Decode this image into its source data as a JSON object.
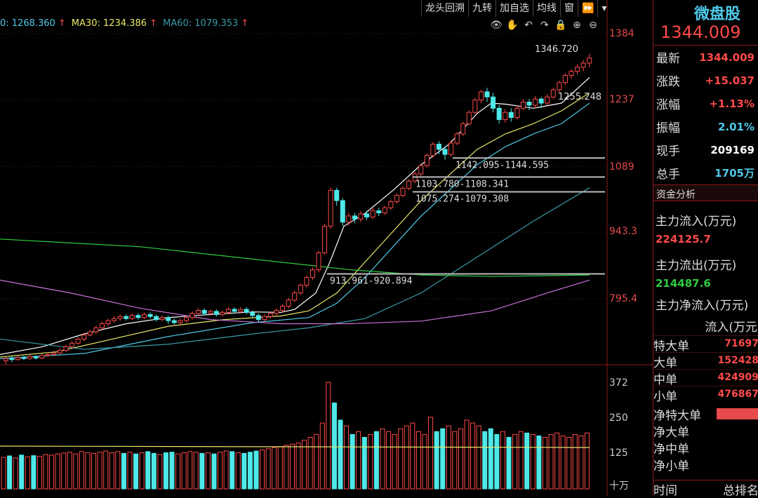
{
  "toolbar": {
    "items": [
      "龙头回溯",
      "九转",
      "加自选",
      "均线",
      "窗"
    ]
  },
  "ma_legend": {
    "ma10": {
      "label": "0: 1268.360",
      "color": "#4ec9e8"
    },
    "ma30": {
      "label": "MA30: 1234.386",
      "color": "#e8e86a"
    },
    "ma60": {
      "label": "MA60: 1079.353",
      "color": "#3a9aa8"
    },
    "up_arrow": "↑"
  },
  "price_axis": [
    "1384",
    "1237",
    "1089",
    "943.3",
    "795.4"
  ],
  "volume_axis": [
    "372",
    "250",
    "125",
    "十万"
  ],
  "annotations": {
    "high": "1346.720",
    "ma_level": "1255.248",
    "gap1": "1142.095-1144.595",
    "gap2": "1103.780-1108.341",
    "gap3": "1075.274-1079.308",
    "gap4": "913.961-920.894"
  },
  "right_panel": {
    "title": "微盘股",
    "price": "1344.009",
    "rows": [
      {
        "key": "最新",
        "value": "1344.009",
        "color": "red"
      },
      {
        "key": "涨跌",
        "value": "+15.037",
        "color": "red"
      },
      {
        "key": "涨幅",
        "value": "+1.13%",
        "color": "red"
      },
      {
        "key": "振幅",
        "value": "2.01%",
        "color": "cyan"
      },
      {
        "key": "现手",
        "value": "209169",
        "color": "white"
      },
      {
        "key": "总手",
        "value": "1705万",
        "color": "cyan"
      }
    ],
    "section": "资金分析",
    "inflow_label": "主力流入(万元)",
    "inflow_value": "224125.7",
    "outflow_label": "主力流出(万元)",
    "outflow_value": "214487.6",
    "net_label": "主力净流入(万元)",
    "table_head": "流入(万元",
    "table_rows": [
      {
        "key": "特大单",
        "value": "71697"
      },
      {
        "key": "大单",
        "value": "152428"
      },
      {
        "key": "中单",
        "value": "424909"
      },
      {
        "key": "小单",
        "value": "476867"
      }
    ],
    "net_rows": [
      "净特大单",
      "净大单",
      "净中单",
      "净小单"
    ],
    "footer_left": "时间",
    "footer_right": "总排名"
  },
  "chart_data": {
    "type": "candlestick",
    "ylim": [
      740,
      1410
    ],
    "candles": [
      [
        748,
        752,
        741,
        755
      ],
      [
        752,
        750,
        745,
        756
      ],
      [
        750,
        754,
        748,
        758
      ],
      [
        754,
        752,
        749,
        757
      ],
      [
        752,
        756,
        750,
        760
      ],
      [
        756,
        753,
        750,
        758
      ],
      [
        753,
        758,
        751,
        762
      ],
      [
        758,
        760,
        755,
        764
      ],
      [
        760,
        763,
        757,
        767
      ],
      [
        763,
        768,
        760,
        772
      ],
      [
        768,
        775,
        765,
        779
      ],
      [
        775,
        782,
        772,
        786
      ],
      [
        782,
        790,
        779,
        794
      ],
      [
        790,
        798,
        786,
        802
      ],
      [
        798,
        804,
        795,
        808
      ],
      [
        804,
        812,
        800,
        816
      ],
      [
        812,
        820,
        808,
        824
      ],
      [
        820,
        826,
        816,
        830
      ],
      [
        826,
        830,
        822,
        835
      ],
      [
        830,
        834,
        826,
        838
      ],
      [
        834,
        830,
        826,
        838
      ],
      [
        830,
        836,
        827,
        840
      ],
      [
        836,
        832,
        828,
        840
      ],
      [
        832,
        838,
        829,
        842
      ],
      [
        838,
        834,
        830,
        842
      ],
      [
        834,
        828,
        824,
        838
      ],
      [
        828,
        832,
        825,
        836
      ],
      [
        832,
        826,
        820,
        836
      ],
      [
        826,
        822,
        818,
        830
      ],
      [
        822,
        826,
        818,
        830
      ],
      [
        826,
        832,
        822,
        836
      ],
      [
        832,
        840,
        828,
        844
      ],
      [
        840,
        846,
        836,
        850
      ],
      [
        846,
        840,
        836,
        850
      ],
      [
        840,
        844,
        836,
        848
      ],
      [
        844,
        838,
        834,
        848
      ],
      [
        838,
        842,
        834,
        846
      ],
      [
        842,
        848,
        838,
        852
      ],
      [
        848,
        844,
        840,
        852
      ],
      [
        844,
        848,
        840,
        852
      ],
      [
        848,
        842,
        838,
        852
      ],
      [
        842,
        836,
        832,
        846
      ],
      [
        836,
        828,
        822,
        840
      ],
      [
        828,
        834,
        824,
        838
      ],
      [
        834,
        840,
        830,
        844
      ],
      [
        840,
        846,
        836,
        850
      ],
      [
        846,
        854,
        842,
        858
      ],
      [
        854,
        866,
        850,
        870
      ],
      [
        866,
        880,
        862,
        884
      ],
      [
        880,
        895,
        876,
        898
      ],
      [
        895,
        910,
        890,
        914
      ],
      [
        910,
        925,
        905,
        930
      ],
      [
        925,
        958,
        920,
        962
      ],
      [
        958,
        1010,
        955,
        1015
      ],
      [
        1010,
        1080,
        1005,
        1085
      ],
      [
        1080,
        1060,
        1050,
        1085
      ],
      [
        1060,
        1018,
        1010,
        1065
      ],
      [
        1018,
        1030,
        1012,
        1036
      ],
      [
        1030,
        1024,
        1016,
        1036
      ],
      [
        1024,
        1034,
        1018,
        1040
      ],
      [
        1034,
        1028,
        1022,
        1040
      ],
      [
        1028,
        1040,
        1024,
        1046
      ],
      [
        1040,
        1036,
        1030,
        1046
      ],
      [
        1036,
        1046,
        1032,
        1050
      ],
      [
        1046,
        1058,
        1042,
        1062
      ],
      [
        1058,
        1070,
        1054,
        1074
      ],
      [
        1070,
        1084,
        1066,
        1088
      ],
      [
        1084,
        1098,
        1080,
        1102
      ],
      [
        1098,
        1112,
        1094,
        1116
      ],
      [
        1112,
        1128,
        1108,
        1132
      ],
      [
        1128,
        1148,
        1124,
        1152
      ],
      [
        1148,
        1170,
        1144,
        1174
      ],
      [
        1170,
        1160,
        1150,
        1176
      ],
      [
        1160,
        1150,
        1140,
        1166
      ],
      [
        1150,
        1172,
        1146,
        1178
      ],
      [
        1172,
        1190,
        1168,
        1194
      ],
      [
        1190,
        1210,
        1186,
        1214
      ],
      [
        1210,
        1232,
        1206,
        1236
      ],
      [
        1232,
        1256,
        1228,
        1260
      ],
      [
        1256,
        1272,
        1250,
        1276
      ],
      [
        1272,
        1262,
        1252,
        1280
      ],
      [
        1262,
        1240,
        1232,
        1270
      ],
      [
        1240,
        1218,
        1210,
        1246
      ],
      [
        1218,
        1232,
        1212,
        1238
      ],
      [
        1232,
        1222,
        1214,
        1240
      ],
      [
        1222,
        1240,
        1218,
        1246
      ],
      [
        1240,
        1252,
        1236,
        1258
      ],
      [
        1252,
        1246,
        1236,
        1258
      ],
      [
        1246,
        1258,
        1240,
        1264
      ],
      [
        1258,
        1250,
        1240,
        1262
      ],
      [
        1250,
        1262,
        1246,
        1268
      ],
      [
        1262,
        1276,
        1258,
        1280
      ],
      [
        1276,
        1290,
        1270,
        1294
      ],
      [
        1290,
        1304,
        1286,
        1308
      ],
      [
        1304,
        1312,
        1298,
        1316
      ],
      [
        1312,
        1320,
        1306,
        1326
      ],
      [
        1320,
        1328,
        1312,
        1334
      ],
      [
        1328,
        1338,
        1320,
        1346
      ]
    ],
    "volumes": [
      110,
      115,
      108,
      118,
      112,
      116,
      114,
      120,
      118,
      122,
      125,
      128,
      122,
      130,
      126,
      124,
      128,
      132,
      126,
      130,
      124,
      128,
      122,
      126,
      130,
      124,
      120,
      126,
      128,
      122,
      126,
      130,
      128,
      124,
      126,
      122,
      128,
      132,
      130,
      126,
      124,
      128,
      132,
      136,
      140,
      144,
      148,
      152,
      156,
      160,
      170,
      180,
      190,
      230,
      372,
      300,
      240,
      220,
      190,
      200,
      180,
      190,
      200,
      210,
      200,
      190,
      210,
      220,
      230,
      200,
      190,
      250,
      200,
      210,
      220,
      200,
      210,
      240,
      230,
      220,
      200,
      210,
      190,
      200,
      180,
      190,
      200,
      195,
      190,
      185,
      180,
      190,
      195,
      185,
      180,
      190,
      185,
      195
    ],
    "ma_lines": [
      {
        "color": "#ffffff",
        "points": [
          [
            0,
            760
          ],
          [
            60,
            775
          ],
          [
            120,
            800
          ],
          [
            180,
            820
          ],
          [
            240,
            832
          ],
          [
            300,
            838
          ],
          [
            360,
            843
          ],
          [
            400,
            842
          ],
          [
            420,
            848
          ],
          [
            450,
            880
          ],
          [
            470,
            940
          ],
          [
            490,
            1010
          ],
          [
            520,
            1035
          ],
          [
            560,
            1080
          ],
          [
            600,
            1130
          ],
          [
            640,
            1170
          ],
          [
            680,
            1230
          ],
          [
            700,
            1250
          ],
          [
            720,
            1248
          ],
          [
            760,
            1240
          ],
          [
            800,
            1250
          ],
          [
            840,
            1300
          ]
        ]
      },
      {
        "color": "#e8e86a",
        "points": [
          [
            0,
            755
          ],
          [
            80,
            765
          ],
          [
            160,
            790
          ],
          [
            240,
            815
          ],
          [
            320,
            828
          ],
          [
            400,
            835
          ],
          [
            440,
            845
          ],
          [
            480,
            880
          ],
          [
            520,
            940
          ],
          [
            560,
            1000
          ],
          [
            600,
            1060
          ],
          [
            640,
            1110
          ],
          [
            680,
            1160
          ],
          [
            720,
            1190
          ],
          [
            760,
            1210
          ],
          [
            800,
            1235
          ],
          [
            840,
            1270
          ]
        ]
      },
      {
        "color": "#4ec9e8",
        "points": [
          [
            0,
            752
          ],
          [
            120,
            762
          ],
          [
            240,
            795
          ],
          [
            360,
            822
          ],
          [
            440,
            832
          ],
          [
            480,
            860
          ],
          [
            520,
            910
          ],
          [
            560,
            970
          ],
          [
            600,
            1030
          ],
          [
            640,
            1080
          ],
          [
            680,
            1130
          ],
          [
            720,
            1165
          ],
          [
            760,
            1190
          ],
          [
            800,
            1210
          ],
          [
            840,
            1250
          ]
        ]
      },
      {
        "color": "#3a9aa8",
        "points": [
          [
            0,
            790
          ],
          [
            120,
            770
          ],
          [
            240,
            780
          ],
          [
            360,
            800
          ],
          [
            440,
            812
          ],
          [
            520,
            830
          ],
          [
            600,
            880
          ],
          [
            680,
            950
          ],
          [
            760,
            1020
          ],
          [
            840,
            1085
          ]
        ]
      },
      {
        "color": "#c872d8",
        "points": [
          [
            0,
            905
          ],
          [
            100,
            880
          ],
          [
            200,
            850
          ],
          [
            300,
            828
          ],
          [
            400,
            820
          ],
          [
            500,
            820
          ],
          [
            600,
            825
          ],
          [
            700,
            845
          ],
          [
            780,
            880
          ],
          [
            840,
            905
          ]
        ]
      },
      {
        "color": "#2ecc40",
        "points": [
          [
            0,
            985
          ],
          [
            200,
            970
          ],
          [
            400,
            940
          ],
          [
            500,
            925
          ],
          [
            600,
            915
          ],
          [
            700,
            912
          ],
          [
            840,
            915
          ]
        ]
      }
    ]
  }
}
